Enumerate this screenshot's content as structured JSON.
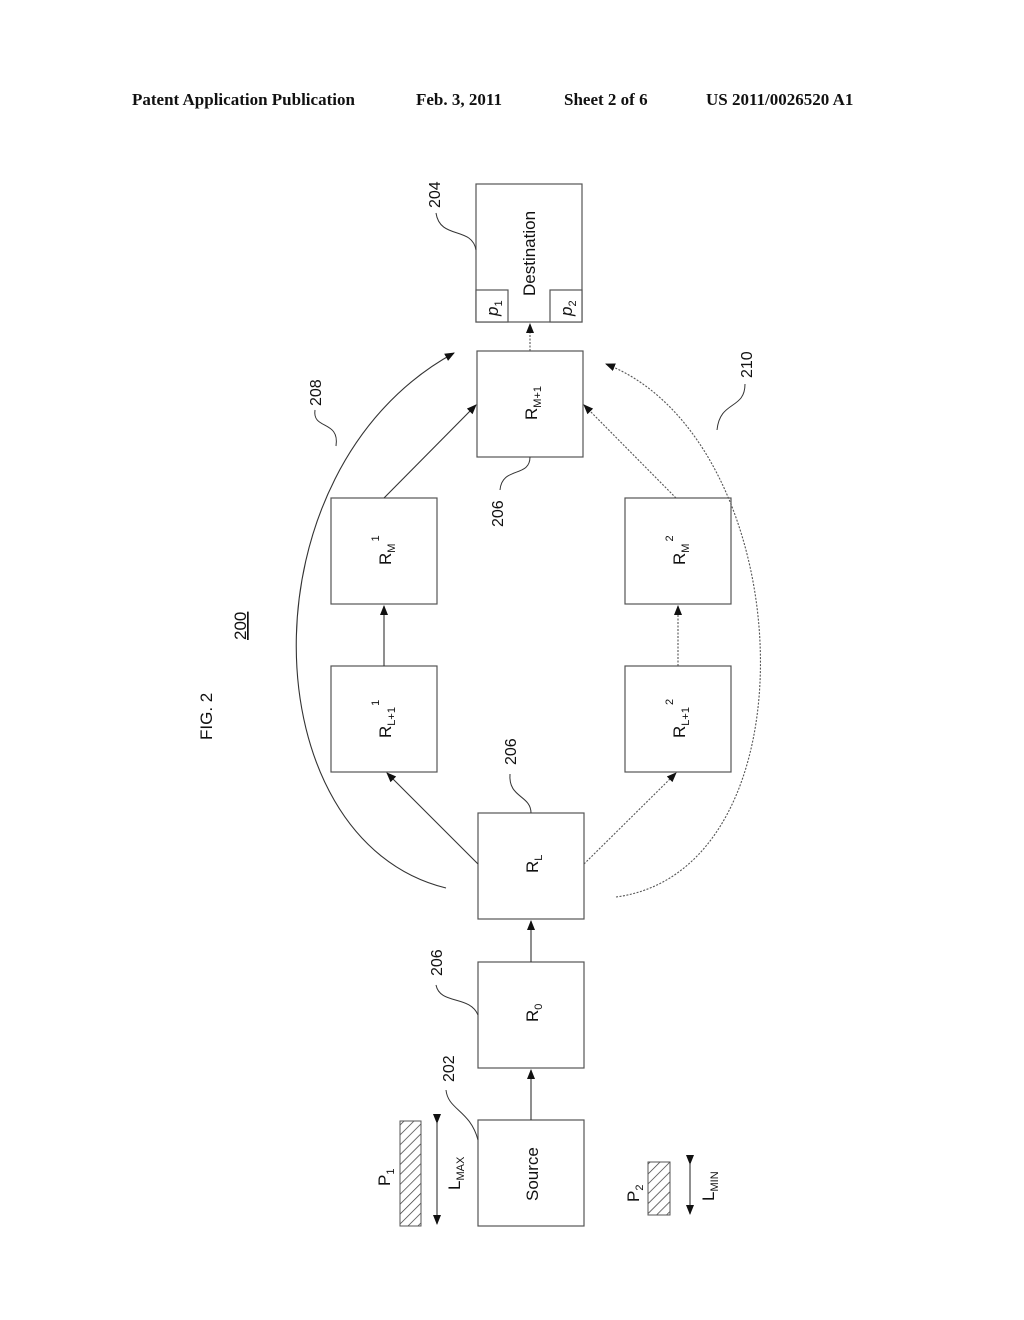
{
  "header": {
    "publication": "Patent Application Publication",
    "date": "Feb. 3, 2011",
    "sheet": "Sheet 2 of 6",
    "number": "US 2011/0026520 A1"
  },
  "figure": {
    "title": "FIG. 2",
    "ref": "200"
  },
  "nodes": {
    "source": {
      "label": "Source",
      "ref": "202"
    },
    "r0": {
      "base": "R",
      "sub": "0",
      "ref": "206"
    },
    "rl": {
      "base": "R",
      "sub": "L",
      "ref": "206"
    },
    "rl1_1": {
      "base": "R",
      "sub": "L+1",
      "sup": "1"
    },
    "rm_1": {
      "base": "R",
      "sub": "M",
      "sup": "1"
    },
    "rl1_2": {
      "base": "R",
      "sub": "L+1",
      "sup": "2"
    },
    "rm_2": {
      "base": "R",
      "sub": "M",
      "sup": "2"
    },
    "rm1": {
      "base": "R",
      "sub": "M+1",
      "ref": "206"
    },
    "destination": {
      "label": "Destination",
      "ref": "204",
      "p1": "p",
      "p1_sub": "1",
      "p2": "p",
      "p2_sub": "2"
    }
  },
  "paths": {
    "path1_ref": "208",
    "path2_ref": "210"
  },
  "packets": {
    "p1": {
      "base": "P",
      "sub": "1",
      "length_base": "L",
      "length_sub": "MAX"
    },
    "p2": {
      "base": "P",
      "sub": "2",
      "length_base": "L",
      "length_sub": "MIN"
    }
  }
}
